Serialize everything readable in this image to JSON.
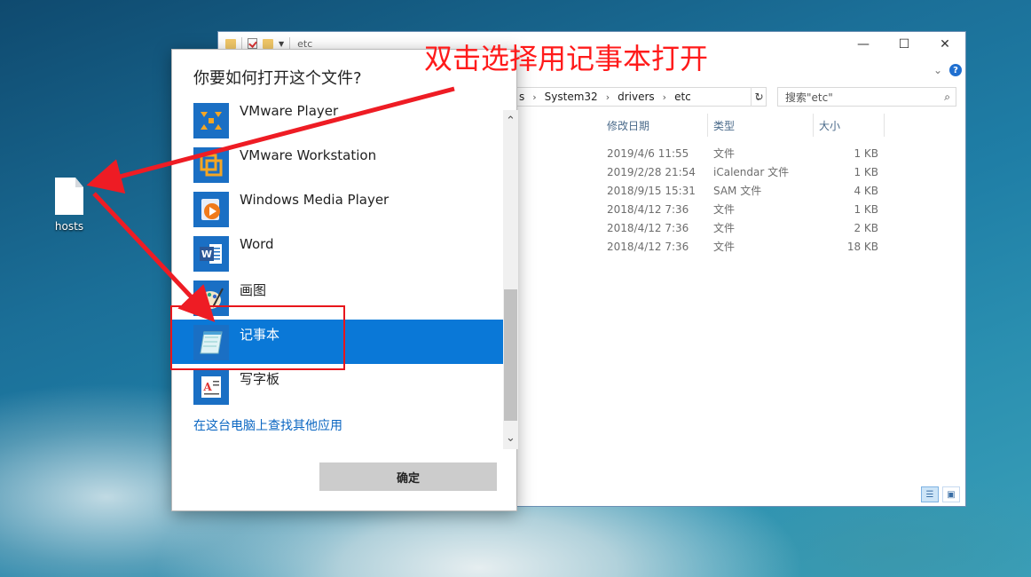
{
  "desktop": {
    "icon_label": "hosts"
  },
  "explorer": {
    "window_title": "etc",
    "minimize": "—",
    "maximize": "☐",
    "close": "✕",
    "address": {
      "partial": "s",
      "crumbs": [
        "System32",
        "drivers",
        "etc"
      ]
    },
    "search_placeholder": "搜索\"etc\"",
    "columns": {
      "date": "修改日期",
      "type": "类型",
      "size": "大小"
    },
    "rows": [
      {
        "date": "2019/4/6 11:55",
        "type": "文件",
        "size": "1 KB"
      },
      {
        "date": "2019/2/28 21:54",
        "type": "iCalendar 文件",
        "size": "1 KB"
      },
      {
        "date": "2018/9/15 15:31",
        "type": "SAM 文件",
        "size": "4 KB"
      },
      {
        "date": "2018/4/12 7:36",
        "type": "文件",
        "size": "1 KB"
      },
      {
        "date": "2018/4/12 7:36",
        "type": "文件",
        "size": "2 KB"
      },
      {
        "date": "2018/4/12 7:36",
        "type": "文件",
        "size": "18 KB"
      }
    ]
  },
  "dialog": {
    "title": "你要如何打开这个文件?",
    "apps": [
      {
        "label": "VMware Player",
        "icon": "vmware-player-icon"
      },
      {
        "label": "VMware Workstation",
        "icon": "vmware-workstation-icon"
      },
      {
        "label": "Windows Media Player",
        "icon": "windows-media-player-icon"
      },
      {
        "label": "Word",
        "icon": "word-icon"
      },
      {
        "label": "画图",
        "icon": "paint-icon"
      },
      {
        "label": "记事本",
        "icon": "notepad-icon",
        "selected": true
      },
      {
        "label": "写字板",
        "icon": "wordpad-icon"
      }
    ],
    "more_apps_link": "在这台电脑上查找其他应用",
    "ok_button": "确定"
  },
  "annotation": {
    "text": "双击选择用记事本打开",
    "color": "#ff1b1b"
  },
  "colors": {
    "selection": "#0a78d7",
    "link": "#0a66c2"
  }
}
